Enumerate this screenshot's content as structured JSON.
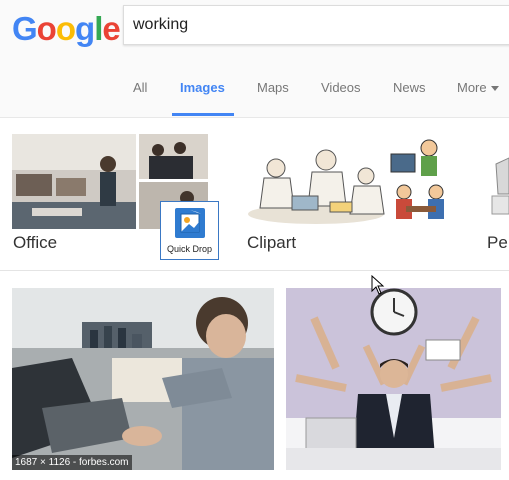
{
  "logo": {
    "letters": [
      "G",
      "o",
      "o",
      "g",
      "l",
      "e"
    ],
    "colors": [
      "#4285f4",
      "#ea4335",
      "#fbbc05",
      "#4285f4",
      "#34a853",
      "#ea4335"
    ]
  },
  "search": {
    "value": "working"
  },
  "tabs": [
    {
      "label": "All",
      "active": false
    },
    {
      "label": "Images",
      "active": true
    },
    {
      "label": "Maps",
      "active": false
    },
    {
      "label": "Videos",
      "active": false
    },
    {
      "label": "News",
      "active": false
    },
    {
      "label": "More",
      "active": false
    }
  ],
  "related": [
    {
      "label": "Office"
    },
    {
      "label": "Clipart"
    },
    {
      "label": "Pe"
    }
  ],
  "results": [
    {
      "meta": "1687 × 1126 - forbes.com"
    },
    {
      "meta": ""
    }
  ],
  "quick_drop": {
    "label": "Quick Drop"
  },
  "colors": {
    "accent": "#4285f4",
    "tab_inactive": "#777777"
  }
}
